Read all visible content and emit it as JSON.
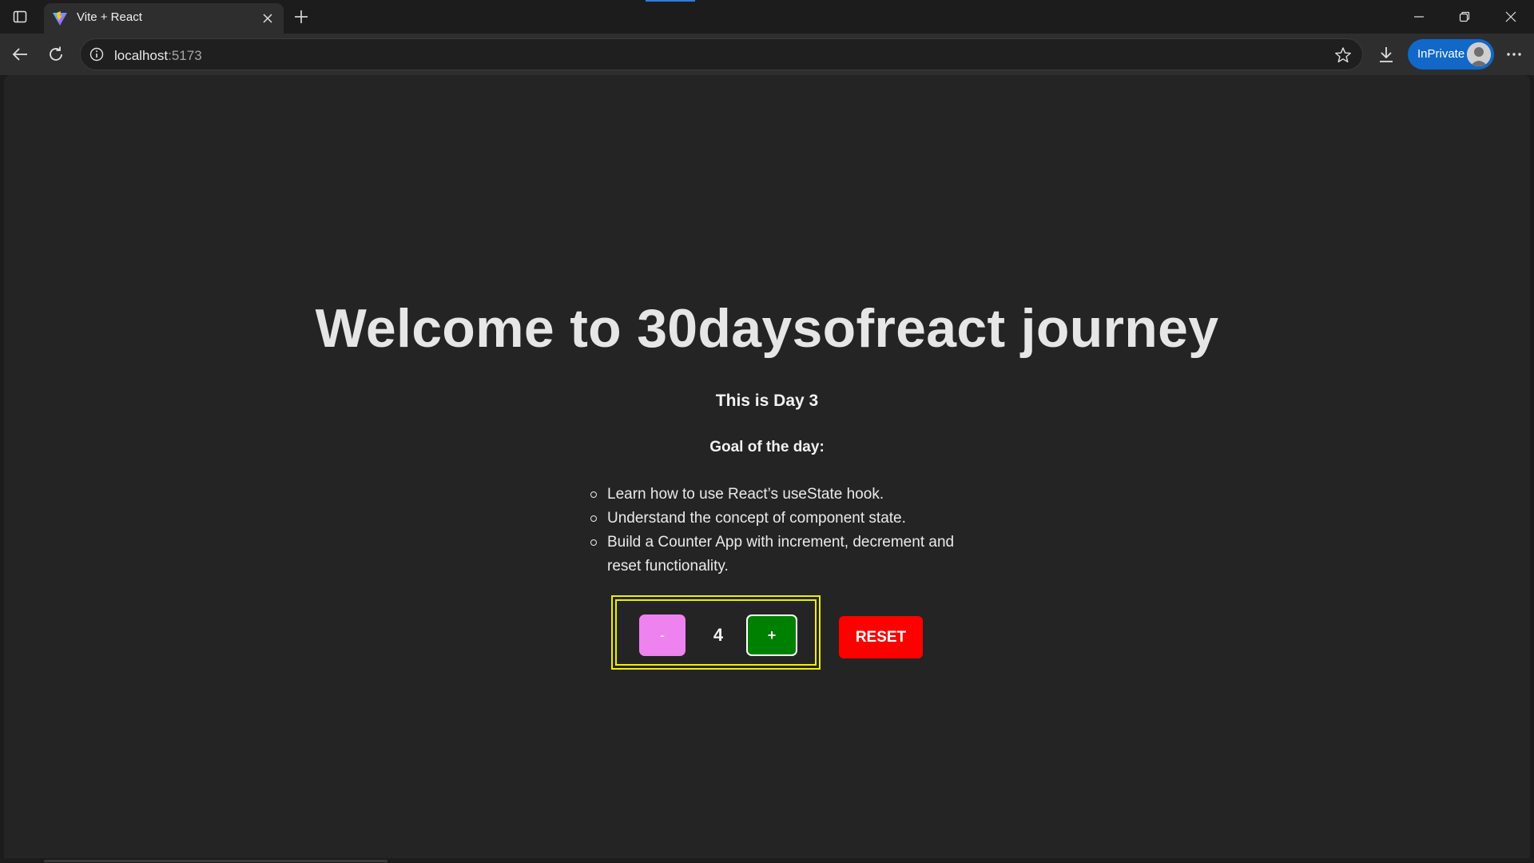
{
  "browser": {
    "tab": {
      "title": "Vite + React"
    },
    "address": {
      "host": "localhost",
      "port": ":5173"
    },
    "profile": {
      "label": "InPrivate"
    }
  },
  "page": {
    "title": "Welcome to 30daysofreact journey",
    "day_heading": "This is Day 3",
    "goal_heading": "Goal of the day:",
    "goals": [
      "Learn how to use React’s useState hook.",
      "Understand the concept of component state.",
      "Build a Counter App with increment, decrement and reset functionality."
    ],
    "counter": {
      "decrement_label": "-",
      "value": "4",
      "increment_label": "+"
    },
    "reset_label": "RESET"
  },
  "colors": {
    "decrement_button": "#ee82ee",
    "increment_button": "#008000",
    "reset_button": "#ff0000",
    "counter_border": "#f0f000",
    "inprivate_badge": "#1168c9"
  },
  "icons": {
    "tab_actions": "tab-actions-icon",
    "favicon": "vite-logo-icon",
    "tab_close": "close-icon",
    "new_tab": "plus-icon",
    "back": "back-arrow-icon",
    "refresh": "refresh-icon",
    "site_info": "info-icon",
    "favorite": "star-icon",
    "downloads": "download-icon",
    "menu": "more-icon"
  }
}
